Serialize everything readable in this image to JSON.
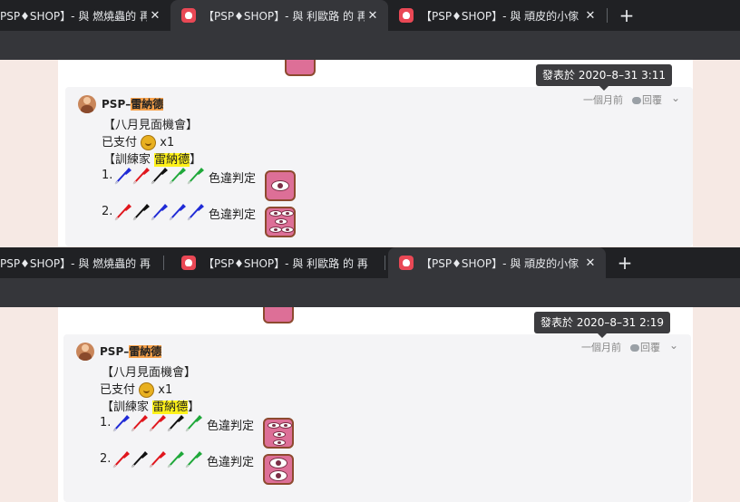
{
  "shots": [
    {
      "tabs": [
        {
          "title": "PSP♦SHOP】- 與 燃燒蟲的 再",
          "close": "✕",
          "active": false
        },
        {
          "title": "【PSP♦SHOP】- 與 利歐路 的 再",
          "close": "✕",
          "active": true
        },
        {
          "title": "【PSP♦SHOP】- 與 頑皮的小傢",
          "close": "✕",
          "active": false
        }
      ],
      "new_tab": "+",
      "tooltip": "發表於 2020–8–31 3:11",
      "comment": {
        "user_prefix": "PSP–",
        "user_name": "雷納德",
        "time": "一個月前",
        "reply": "回覆",
        "lines": {
          "event": "【八月見面機會】",
          "paid": "已支付",
          "paid_qty": "x1",
          "trainer_prefix": "【訓練家 ",
          "trainer_name": "雷納德",
          "trainer_suffix": "】",
          "row1_num": "1.",
          "row1_label": "色違判定",
          "row2_num": "2.",
          "row2_label": "色違判定"
        },
        "row1_colors": [
          "#1f2ad6",
          "#e0161d",
          "#111111",
          "#1fa83a",
          "#1fa83a"
        ],
        "row2_colors": [
          "#e0161d",
          "#111111",
          "#1f2ad6",
          "#1f2ad6",
          "#1f2ad6"
        ],
        "row1_sticker": "one-eye-sticker",
        "row2_sticker": "many-eyes-sticker"
      }
    },
    {
      "tabs": [
        {
          "title": "PSP♦SHOP】- 與 燃燒蟲的 再",
          "close": "",
          "active": false
        },
        {
          "title": "【PSP♦SHOP】- 與 利歐路 的 再",
          "close": "",
          "active": false
        },
        {
          "title": "【PSP♦SHOP】- 與 頑皮的小傢",
          "close": "✕",
          "active": true
        }
      ],
      "new_tab": "+",
      "tooltip": "發表於 2020–8–31 2:19",
      "comment": {
        "user_prefix": "PSP–",
        "user_name": "雷納德",
        "time": "一個月前",
        "reply": "回覆",
        "lines": {
          "event": "【八月見面機會】",
          "paid": "已支付",
          "paid_qty": "x1",
          "trainer_prefix": "【訓練家 ",
          "trainer_name": "雷納德",
          "trainer_suffix": "】",
          "row1_num": "1.",
          "row1_label": "色違判定",
          "row2_num": "2.",
          "row2_label": "色違判定"
        },
        "row1_colors": [
          "#1f2ad6",
          "#e0161d",
          "#e0161d",
          "#111111",
          "#1fa83a"
        ],
        "row2_colors": [
          "#e0161d",
          "#111111",
          "#e0161d",
          "#1fa83a",
          "#1fa83a"
        ],
        "row1_sticker": "few-eyes-sticker",
        "row2_sticker": "two-eyes-sticker"
      }
    }
  ],
  "colors": {
    "tabstrip": "#202124",
    "active_tab": "#35363a",
    "page_bg": "#f6e9e4",
    "comment_bg": "#f4f4f6",
    "name_highlight": "#f7a14a",
    "trainer_highlight": "#fff21a",
    "sticker": "#dd6f97"
  }
}
